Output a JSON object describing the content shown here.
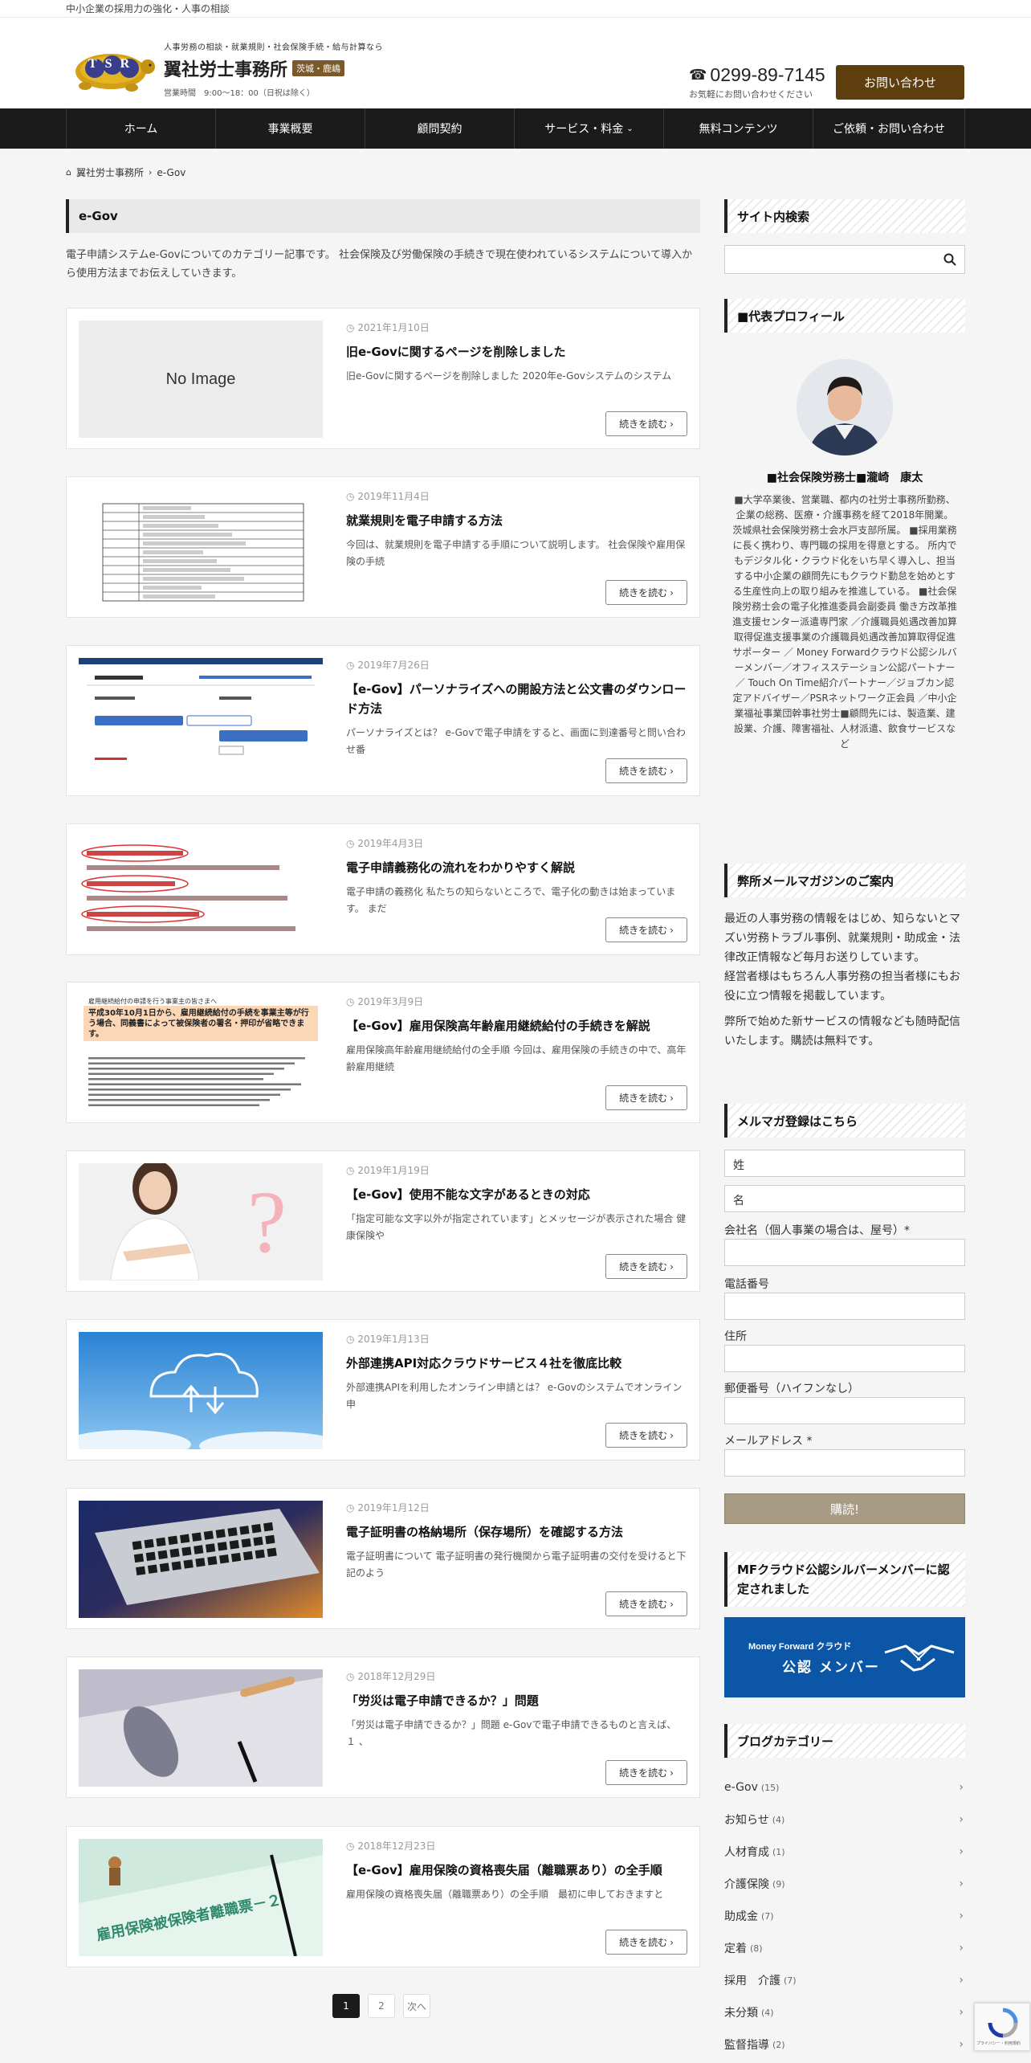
{
  "topbar": {
    "text": "中小企業の採用力の強化・人事の相談"
  },
  "header": {
    "logo_letters": "TSR",
    "tagline": "人事労務の相談・就業規則・社会保険手続・給与計算なら",
    "site_name": "翼社労士事務所",
    "badge": "茨城・鹿嶋",
    "hours": "営業時間　9:00～18：00（日祝は除く）",
    "phone": "0299-89-7145",
    "phone_sub": "お気軽にお問い合わせください",
    "contact_label": "お問い合わせ"
  },
  "nav": {
    "items": [
      {
        "label": "ホーム"
      },
      {
        "label": "事業概要"
      },
      {
        "label": "顧問契約"
      },
      {
        "label": "サービス・料金"
      },
      {
        "label": "無料コンテンツ"
      },
      {
        "label": "ご依頼・お問い合わせ"
      }
    ]
  },
  "breadcrumb": {
    "home": "翼社労士事務所",
    "current": "e-Gov"
  },
  "archive": {
    "title": "e-Gov",
    "description": "電子申請システムe-Govについてのカテゴリー記事です。 社会保険及び労働保険の手続きで現在使われているシステムについて導入から使用方法までお伝えしていきます。"
  },
  "read_more_label": "続きを読む",
  "no_image_label": "No Image",
  "posts": [
    {
      "date": "2021年1月10日",
      "title": "旧e-Govに関するページを削除しました",
      "excerpt": "旧e-Govに関するページを削除しました 2020年e-Govシステムのシステム",
      "thumb": "no-image"
    },
    {
      "date": "2019年11月4日",
      "title": "就業規則を電子申請する方法",
      "excerpt": "今回は、就業規則を電子申請する手順について説明します。 社会保険や雇用保険の手続",
      "thumb": "form"
    },
    {
      "date": "2019年7月26日",
      "title": "【e-Gov】パーソナライズへの開設方法と公文書のダウンロード方法",
      "excerpt": "パーソナライズとは？ e-Govで電子申請をすると、画面に到達番号と問い合わせ番",
      "thumb": "screen"
    },
    {
      "date": "2019年4月3日",
      "title": "電子申請義務化の流れをわかりやすく解説",
      "excerpt": "電子申請の義務化 私たちの知らないところで、電子化の動きは始まっています。 まだ",
      "thumb": "notes"
    },
    {
      "date": "2019年3月9日",
      "title": "【e-Gov】雇用保険高年齢雇用継続給付の手続きを解説",
      "excerpt": "雇用保険高年齢雇用継続給付の全手順 今回は、雇用保険の手続きの中で、高年齢雇用継続",
      "thumb": "notice"
    },
    {
      "date": "2019年1月19日",
      "title": "【e-Gov】使用不能な文字があるときの対応",
      "excerpt": "「指定可能な文字以外が指定されています」とメッセージが表示された場合 健康保険や",
      "thumb": "question"
    },
    {
      "date": "2019年1月13日",
      "title": "外部連携API対応クラウドサービス４社を徹底比較",
      "excerpt": "外部連携APIを利用したオンライン申請とは？ e-Govのシステムでオンライン申",
      "thumb": "cloud"
    },
    {
      "date": "2019年1月12日",
      "title": "電子証明書の格納場所（保存場所）を確認する方法",
      "excerpt": "電子証明書について 電子証明書の発行機関から電子証明書の交付を受けると下記のよう",
      "thumb": "laptop"
    },
    {
      "date": "2018年12月29日",
      "title": "「労災は電子申請できるか？」問題",
      "excerpt": "「労災は電子申請できるか？」問題 e-Govで電子申請できるものと言えば、 １ 、",
      "thumb": "pen"
    },
    {
      "date": "2018年12月23日",
      "title": "【e-Gov】雇用保険の資格喪失届（離職票あり）の全手順",
      "excerpt": "雇用保険の資格喪失届（離職票あり）の全手順　最初に申しておきますと",
      "thumb": "insurance"
    }
  ],
  "notice_thumb": {
    "head": "雇用継続給付の申請を行う事業主の皆さまへ",
    "banner": "平成30年10月1日から、雇用継続給付の手続を事業主等が行う場合、同義書によって被保険者の署名・押印が省略できます。",
    "insurance_doc": "雇用保険被保険者離職票－２"
  },
  "pagination": {
    "pages": [
      "1",
      "2"
    ],
    "next": "次へ"
  },
  "sidebar": {
    "search_title": "サイト内検索",
    "profile_title": "■代表プロフィール",
    "profile_name": "■社会保険労務士■瀧崎　康太",
    "profile_bio": "■大学卒業後、営業職、都内の社労士事務所勤務、企業の総務、医療・介護事務を経て2018年開業。 茨城県社会保険労務士会水戸支部所属。 ■採用業務に長く携わり、専門職の採用を得意とする。 所内でもデジタル化・クラウド化をいち早く導入し、担当する中小企業の顧問先にもクラウド勤怠を始めとする生産性向上の取り組みを推進している。 ■社会保険労務士会の電子化推進委員会副委員 働き方改革推進支援センター派遣専門家 ／介護職員処遇改善加算取得促進支援事業の介護職員処遇改善加算取得促進サポーター ／ Money Forwardクラウド公認シルバーメンバー／オフィスステーション公認パートナー／ Touch On Time紹介パートナー／ジョブカン認定アドバイザー／PSRネットワーク正会員 ／中小企業福祉事業団幹事社労士■顧問先には、製造業、建設業、介護、障害福祉、人材派遣、飲食サービスなど",
    "magazine_title": "弊所メールマガジンのご案内",
    "magazine_p1": "最近の人事労務の情報をはじめ、知らないとマズい労務トラブル事例、就業規則・助成金・法律改正情報など毎月お送りしています。",
    "magazine_p1b": "経営者様はもちろん人事労務の担当者様にもお役に立つ情報を掲載しています。",
    "magazine_p2": "弊所で始めた新サービスの情報なども随時配信いたします。購読は無料です。",
    "form_title": "メルマガ登録はこちら",
    "form": {
      "last_name_placeholder": "姓",
      "first_name_placeholder": "名",
      "company_label": "会社名（個人事業の場合は、屋号）*",
      "phone_label": "電話番号",
      "address_label": "住所",
      "zip_label": "郵便番号（ハイフンなし）",
      "email_label": "メールアドレス *",
      "submit_label": "購読!"
    },
    "mf_title": "MFクラウド公認シルバーメンバーに認定されました",
    "mf_banner_brand": "Money Forward クラウド",
    "mf_banner_text": "公認 メンバー",
    "category_title": "ブログカテゴリー",
    "categories": [
      {
        "name": "e-Gov",
        "count": "(15)"
      },
      {
        "name": "お知らせ",
        "count": "(4)"
      },
      {
        "name": "人材育成",
        "count": "(1)"
      },
      {
        "name": "介護保険",
        "count": "(9)"
      },
      {
        "name": "助成金",
        "count": "(7)"
      },
      {
        "name": "定着",
        "count": "(8)"
      },
      {
        "name": "採用　介護",
        "count": "(7)"
      },
      {
        "name": "未分類",
        "count": "(4)"
      },
      {
        "name": "監督指導",
        "count": "(2)"
      }
    ]
  },
  "recaptcha": {
    "text": "プライバシー・利用規約"
  },
  "colors": {
    "nav_bg": "#1b1b1b",
    "accent_brown": "#5e3d0e",
    "submit": "#a89b83",
    "mf_blue": "#0b56a6"
  }
}
